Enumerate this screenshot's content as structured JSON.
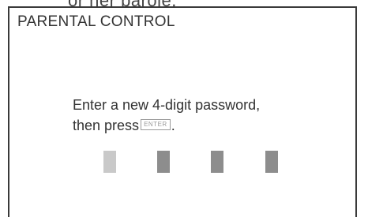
{
  "top_fragment": "or her parole.",
  "dialog": {
    "title": "PARENTAL CONTROL",
    "prompt_line1": "Enter a new 4-digit password,",
    "prompt_line2_prefix": "then press",
    "enter_key_label": "ENTER",
    "prompt_line2_suffix": "."
  },
  "password_fields": [
    {
      "state": "active",
      "color": "#c9c9c9"
    },
    {
      "state": "empty",
      "color": "#8d8d8d"
    },
    {
      "state": "empty",
      "color": "#8d8d8d"
    },
    {
      "state": "empty",
      "color": "#8d8d8d"
    }
  ]
}
